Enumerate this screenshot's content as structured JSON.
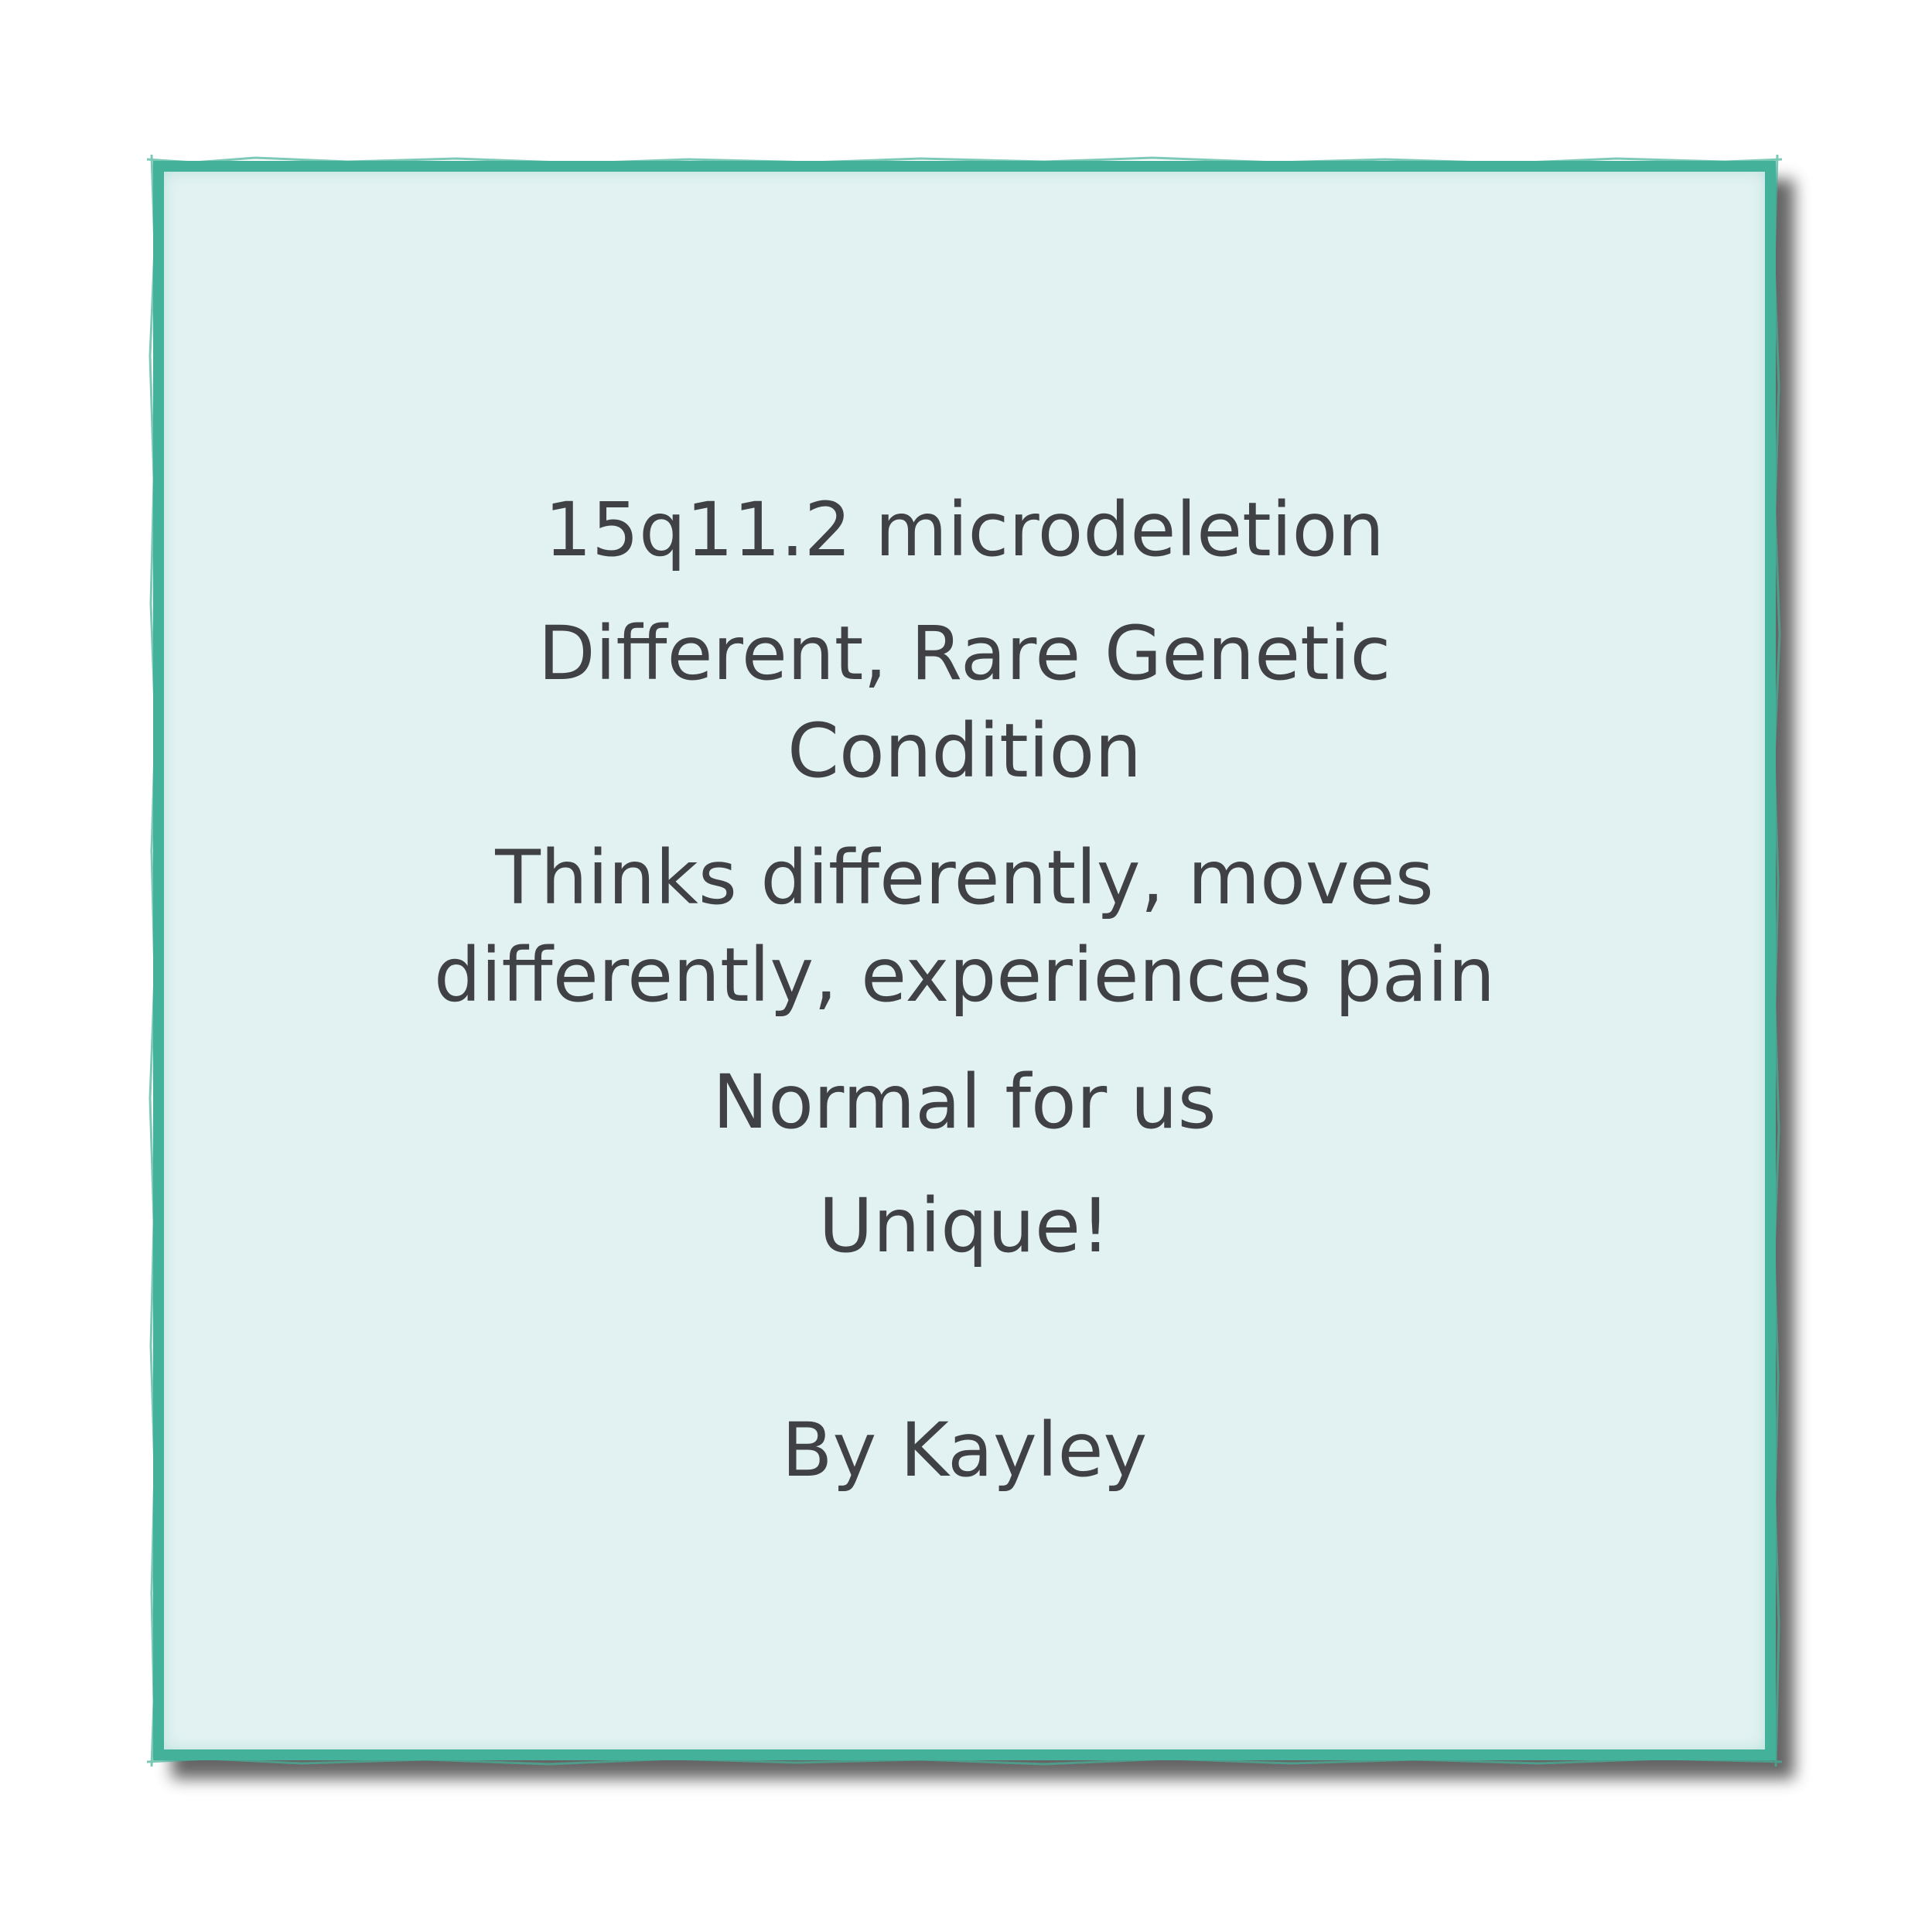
{
  "lines": [
    "15q11.2 microdeletion",
    "Different, Rare Genetic",
    "Condition",
    "Thinks differently, moves",
    "differently, experiences pain",
    "Normal for us",
    "Unique!",
    "By Kayley"
  ],
  "colors": {
    "border": "#44b29a",
    "card_background": "#e2f2f2",
    "text": "#3f4145",
    "shadow": "#4a4a4a",
    "page_background": "#ffffff"
  }
}
